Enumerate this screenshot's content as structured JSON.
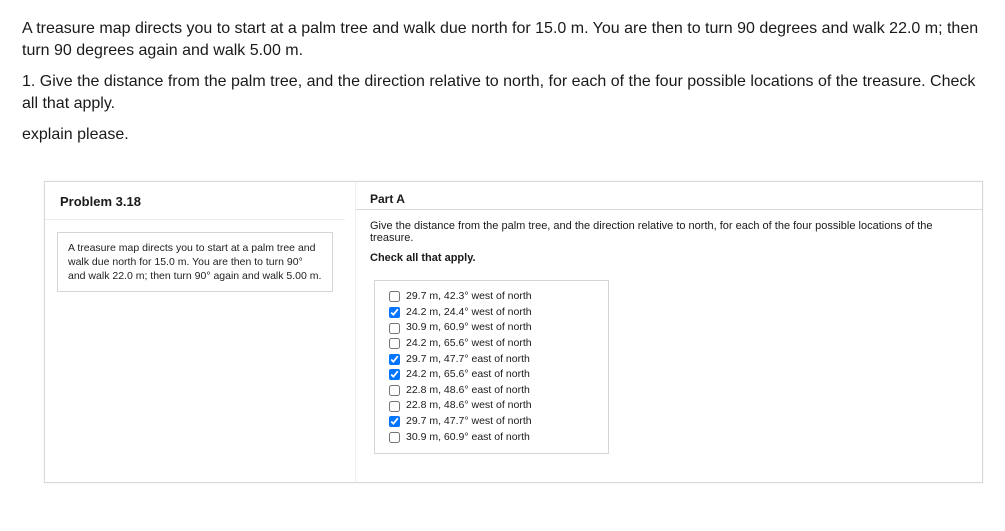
{
  "intro": {
    "p1": "A treasure map directs you to start at a palm tree and walk due north for 15.0 m. You are then to turn 90 degrees and walk 22.0 m; then turn 90 degrees again and walk 5.00 m.",
    "p2": "1. Give the distance from the palm tree, and the direction relative to north, for each of the four possible locations of the treasure. Check all that apply.",
    "p3": "explain please."
  },
  "panel": {
    "title": "Problem 3.18",
    "box_text": "A treasure map directs you to start at a palm tree and walk due north for 15.0 m. You are then to turn 90° and walk 22.0 m; then turn 90° again and walk 5.00 m."
  },
  "partA": {
    "label": "Part A",
    "question": "Give the distance from the palm tree, and the direction relative to north, for each of the four possible locations of the treasure.",
    "check_label": "Check all that apply.",
    "options": [
      {
        "text": "29.7 m, 42.3° west of north",
        "checked": false
      },
      {
        "text": "24.2 m, 24.4° west of north",
        "checked": true
      },
      {
        "text": "30.9 m, 60.9° west of north",
        "checked": false
      },
      {
        "text": "24.2 m, 65.6° west of north",
        "checked": false
      },
      {
        "text": "29.7 m, 47.7° east of north",
        "checked": true
      },
      {
        "text": "24.2 m, 65.6° east of north",
        "checked": true
      },
      {
        "text": "22.8 m, 48.6° east of north",
        "checked": false
      },
      {
        "text": "22.8 m, 48.6° west of north",
        "checked": false
      },
      {
        "text": "29.7 m, 47.7° west of north",
        "checked": true
      },
      {
        "text": "30.9 m, 60.9° east of north",
        "checked": false
      }
    ]
  }
}
